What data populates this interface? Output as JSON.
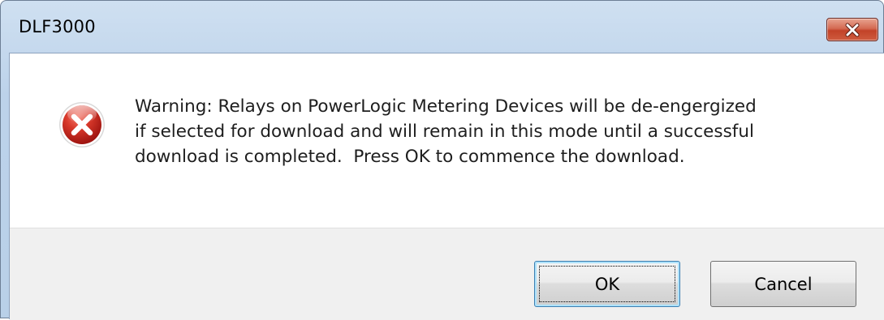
{
  "dialog": {
    "title": "DLF3000",
    "close_icon": "close-icon",
    "icon": "error-icon",
    "message": "Warning: Relays on PowerLogic Metering Devices will be de-engergized\nif selected for download and will remain in this mode until a successful\ndownload is completed.  Press OK to commence the download.",
    "buttons": {
      "ok_label": "OK",
      "cancel_label": "Cancel"
    }
  },
  "colors": {
    "titlebar": "#bcd2ea",
    "close_button": "#c24228",
    "error_icon": "#c8231b",
    "button_area": "#f0f0f0"
  }
}
